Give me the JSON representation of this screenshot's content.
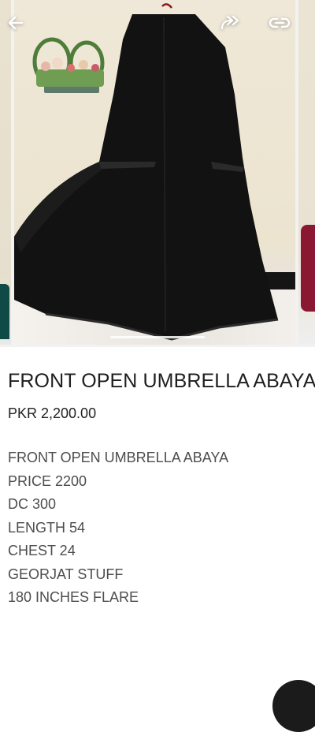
{
  "navigation": {
    "back_icon": "arrow-left-icon",
    "share_icon": "share-forward-icon",
    "link_icon": "link-icon"
  },
  "gallery": {
    "image_alt": "Black front open umbrella abaya on mannequin",
    "colors": {
      "garment": "#111111",
      "wall": "#efe8d8",
      "left_peek": "#0f4a47",
      "right_peek": "#8a1832"
    }
  },
  "product": {
    "title": "FRONT OPEN UMBRELLA ABAYA",
    "price": "PKR 2,200.00",
    "description": [
      "FRONT OPEN UMBRELLA ABAYA",
      "PRICE 2200",
      "DC 300",
      "LENGTH 54",
      "CHEST 24",
      "GEORJAT STUFF",
      "180 INCHES FLARE"
    ]
  }
}
